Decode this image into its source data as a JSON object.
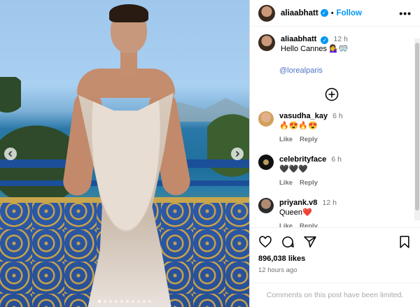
{
  "post": {
    "username": "aliaabhatt",
    "follow_label": "Follow",
    "more_label": "•••",
    "caption": {
      "username": "aliaabhatt",
      "time": "12 h",
      "text": "Hello Cannes 💁‍♀️🥽",
      "mention": "@lorealparis"
    },
    "likes": "896,038 likes",
    "posted": "12 hours ago",
    "limited_notice": "Comments on this post have been limited."
  },
  "comments": [
    {
      "username": "vasudha_kay",
      "time": "6 h",
      "text": "🔥😍🔥😍",
      "like": "Like",
      "reply": "Reply"
    },
    {
      "username": "celebrityface",
      "time": "6 h",
      "text": "🖤🖤🖤",
      "like": "Like",
      "reply": "Reply"
    },
    {
      "username": "priyank.v8",
      "time": "12 h",
      "text": "Queen❤️",
      "like": "Like",
      "reply": "Reply"
    }
  ],
  "carousel": {
    "count": 10,
    "active": 0
  },
  "colors": {
    "accent": "#0095f6",
    "mention": "#4f73c7",
    "muted": "#737373"
  }
}
